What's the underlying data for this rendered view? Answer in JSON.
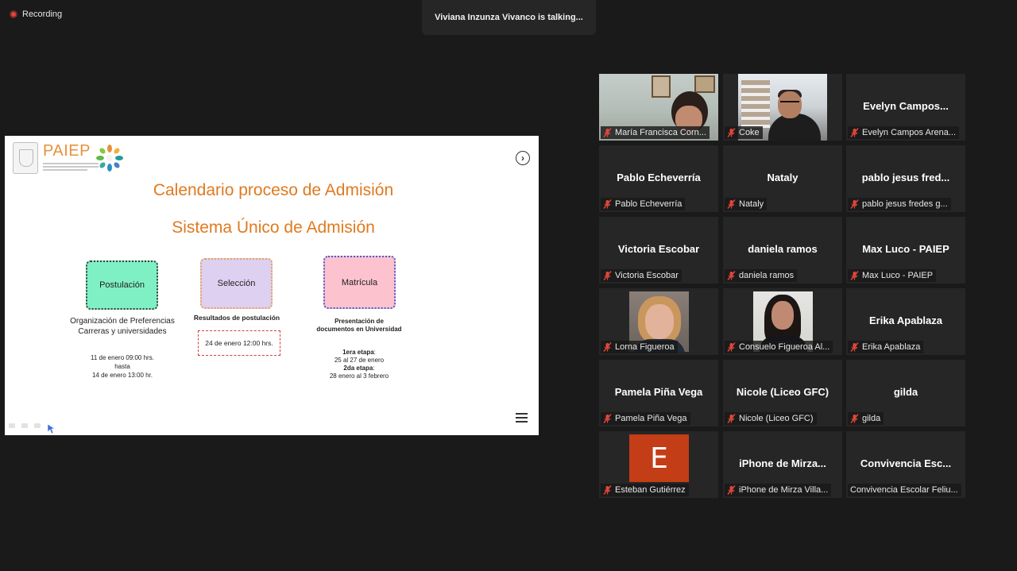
{
  "recording": {
    "label": "Recording"
  },
  "talking": {
    "text": "Viviana Inzunza Vivanco is talking..."
  },
  "slide": {
    "title": "Calendario proceso de Admisión",
    "subtitle": "Sistema Único de Admisión",
    "logo": {
      "text": "PAIEP"
    },
    "steps": [
      {
        "label": "Postulación",
        "detail": "Organización de Preferencias\nCarreras y universidades",
        "dates": "11 de enero 09:00 hrs.\nhasta\n14 de enero 13:00 hr."
      },
      {
        "label": "Selección",
        "detail": "Resultados de postulación",
        "dates": "24 de enero 12:00 hrs."
      },
      {
        "label": "Matrícula",
        "detail": "Presentación de documentos en Universidad",
        "stage1_label": "1era etapa",
        "stage1_dates": "25 al 27 de enero",
        "stage2_label": "2da etapa",
        "stage2_dates": "28 enero al 3 febrero"
      }
    ]
  },
  "participants": [
    {
      "display": "",
      "label": "María Francisca Corn...",
      "video": true,
      "muted": true
    },
    {
      "display": "",
      "label": "Coke",
      "video": true,
      "muted": true
    },
    {
      "display": "Evelyn  Campos...",
      "label": "Evelyn Campos Arena...",
      "video": false,
      "muted": true
    },
    {
      "display": "Pablo Echeverría",
      "label": "Pablo Echeverría",
      "video": false,
      "muted": true
    },
    {
      "display": "Nataly",
      "label": "Nataly",
      "video": false,
      "muted": true
    },
    {
      "display": "pablo jesus fred...",
      "label": "pablo jesus fredes g...",
      "video": false,
      "muted": true
    },
    {
      "display": "Victoria Escobar",
      "label": "Victoria Escobar",
      "video": false,
      "muted": true
    },
    {
      "display": "daniela ramos",
      "label": "daniela ramos",
      "video": false,
      "muted": true
    },
    {
      "display": "Max Luco - PAIEP",
      "label": "Max Luco - PAIEP",
      "video": false,
      "muted": true
    },
    {
      "display": "",
      "label": "Lorna Figueroa",
      "video": true,
      "muted": true
    },
    {
      "display": "",
      "label": "Consuelo Figueroa Al...",
      "video": true,
      "muted": true
    },
    {
      "display": "Erika Apablaza",
      "label": "Erika Apablaza",
      "video": false,
      "muted": true
    },
    {
      "display": "Pamela Piña Vega",
      "label": "Pamela Piña Vega",
      "video": false,
      "muted": true
    },
    {
      "display": "Nicole (Liceo GFC)",
      "label": "Nicole (Liceo GFC)",
      "video": false,
      "muted": true
    },
    {
      "display": "gilda",
      "label": "gilda",
      "video": false,
      "muted": true
    },
    {
      "display": "",
      "avatar_letter": "E",
      "label": "Esteban Gutiérrez",
      "video": false,
      "muted": true
    },
    {
      "display": "iPhone  de  Mirza...",
      "label": "iPhone de Mirza Villa...",
      "video": false,
      "muted": true
    },
    {
      "display": "Convivencia  Esc...",
      "label": "Convivencia Escolar Feliu...",
      "video": false,
      "muted": false
    }
  ],
  "colors": {
    "background": "#1a1a1a",
    "tile": "#262626",
    "slide_title": "#e07a1f",
    "muted_icon": "#e0463a"
  },
  "icons": [
    "record-icon",
    "next-slide-icon",
    "slide-menu-icon",
    "muted-mic-icon",
    "pointer-icon"
  ]
}
